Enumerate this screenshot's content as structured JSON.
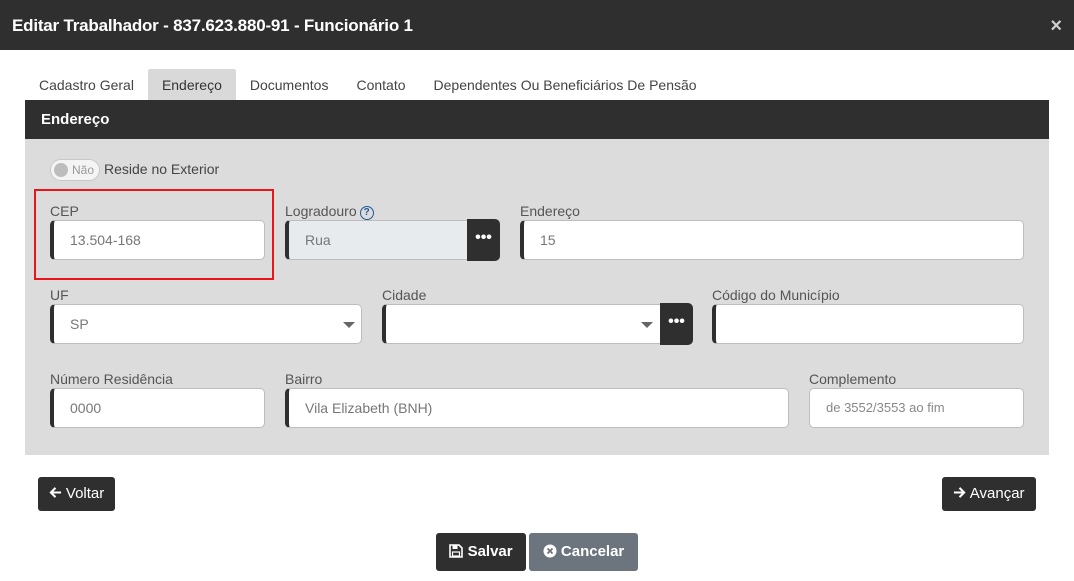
{
  "dialog": {
    "title": "Editar Trabalhador - 837.623.880-91 - Funcionário 1",
    "close_glyph": "×"
  },
  "tabs": [
    {
      "label": "Cadastro Geral",
      "active": false
    },
    {
      "label": "Endereço",
      "active": true
    },
    {
      "label": "Documentos",
      "active": false
    },
    {
      "label": "Contato",
      "active": false
    },
    {
      "label": "Dependentes Ou Beneficiários De Pensão",
      "active": false
    }
  ],
  "section": {
    "title": "Endereço"
  },
  "reside_exterior": {
    "toggle_label": "Não",
    "label": "Reside no Exterior",
    "checked": false
  },
  "fields": {
    "cep": {
      "label": "CEP",
      "value": "13.504-168"
    },
    "logradouro": {
      "label": "Logradouro",
      "value": "Rua",
      "help_glyph": "?"
    },
    "endereco": {
      "label": "Endereço",
      "value": "15"
    },
    "uf": {
      "label": "UF",
      "value": "SP"
    },
    "cidade": {
      "label": "Cidade",
      "value": ""
    },
    "codigo_municipio": {
      "label": "Código do Município",
      "value": ""
    },
    "numero": {
      "label": "Número Residência",
      "value": "0000"
    },
    "bairro": {
      "label": "Bairro",
      "value": "Vila Elizabeth (BNH)"
    },
    "complemento": {
      "label": "Complemento",
      "placeholder": "de 3552/3553 ao fim"
    }
  },
  "buttons": {
    "voltar": "Voltar",
    "avancar": "Avançar",
    "salvar": "Salvar",
    "cancelar": "Cancelar",
    "dots": "•••"
  },
  "icons": {
    "voltar": "arrow-left-icon",
    "avancar": "arrow-right-icon",
    "salvar": "floppy-disk-icon",
    "cancelar": "x-circle-icon"
  },
  "colors": {
    "header": "#2f2f2f",
    "panel": "#dcdcdc",
    "highlight": "#e8151b",
    "cancel": "#6c757d",
    "help": "#1f5a96"
  }
}
